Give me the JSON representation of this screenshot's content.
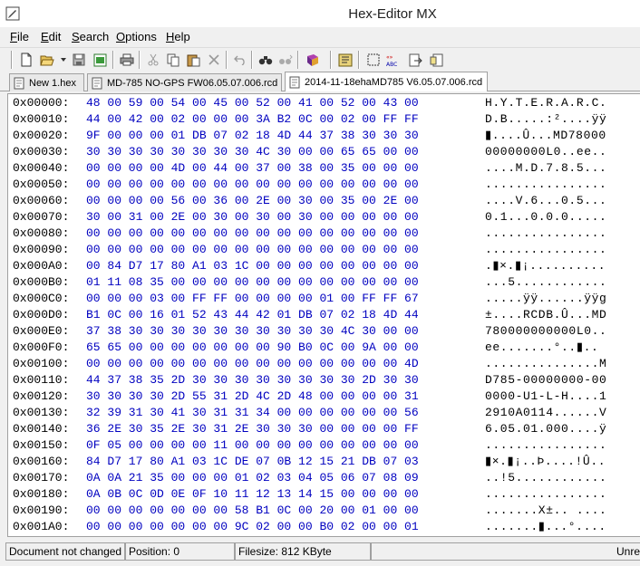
{
  "window": {
    "title": "Hex-Editor MX"
  },
  "menu": [
    {
      "label": "File",
      "accel": "F",
      "rest": "ile"
    },
    {
      "label": "Edit",
      "accel": "E",
      "rest": "dit"
    },
    {
      "label": "Search",
      "accel": "S",
      "rest": "earch"
    },
    {
      "label": "Options",
      "accel": "O",
      "rest": "ptions"
    },
    {
      "label": "Help",
      "accel": "H",
      "rest": "elp"
    }
  ],
  "toolbar": {
    "icons": [
      "new-icon",
      "open-icon",
      "save-icon",
      "save-all-icon",
      "print-icon",
      "cut-icon",
      "copy-icon",
      "paste-icon",
      "delete-icon",
      "undo-icon",
      "find-icon",
      "find-next-icon",
      "bookmark-icon",
      "settings-icon",
      "select-icon",
      "encoding-icon",
      "export-icon",
      "import-icon"
    ]
  },
  "tabs": [
    {
      "label": "New 1.hex",
      "active": false
    },
    {
      "label": "MD-785 NO-GPS FW06.05.07.006.rcd",
      "active": false
    },
    {
      "label": "2014-11-18ehaMD785 V6.05.07.006.rcd",
      "active": true
    }
  ],
  "hex_rows": [
    {
      "addr": "0x00000:",
      "hex": "48 00 59 00 54 00 45 00 52 00 41 00 52 00 43 00",
      "ascii": "H.Y.T.E.R.A.R.C."
    },
    {
      "addr": "0x00010:",
      "hex": "44 00 42 00 02 00 00 00 3A B2 0C 00 02 00 FF FF",
      "ascii": "D.B.....:²....ÿÿ"
    },
    {
      "addr": "0x00020:",
      "hex": "9F 00 00 00 01 DB 07 02 18 4D 44 37 38 30 30 30",
      "ascii": "▮....Û...MD78000"
    },
    {
      "addr": "0x00030:",
      "hex": "30 30 30 30 30 30 30 30 4C 30 00 00 65 65 00 00",
      "ascii": "00000000L0..ee.."
    },
    {
      "addr": "0x00040:",
      "hex": "00 00 00 00 4D 00 44 00 37 00 38 00 35 00 00 00",
      "ascii": "....M.D.7.8.5..."
    },
    {
      "addr": "0x00050:",
      "hex": "00 00 00 00 00 00 00 00 00 00 00 00 00 00 00 00",
      "ascii": "................"
    },
    {
      "addr": "0x00060:",
      "hex": "00 00 00 00 56 00 36 00 2E 00 30 00 35 00 2E 00",
      "ascii": "....V.6...0.5..."
    },
    {
      "addr": "0x00070:",
      "hex": "30 00 31 00 2E 00 30 00 30 00 30 00 00 00 00 00",
      "ascii": "0.1...0.0.0....."
    },
    {
      "addr": "0x00080:",
      "hex": "00 00 00 00 00 00 00 00 00 00 00 00 00 00 00 00",
      "ascii": "................"
    },
    {
      "addr": "0x00090:",
      "hex": "00 00 00 00 00 00 00 00 00 00 00 00 00 00 00 00",
      "ascii": "................"
    },
    {
      "addr": "0x000A0:",
      "hex": "00 84 D7 17 80 A1 03 1C 00 00 00 00 00 00 00 00",
      "ascii": ".▮×.▮¡.........."
    },
    {
      "addr": "0x000B0:",
      "hex": "01 11 08 35 00 00 00 00 00 00 00 00 00 00 00 00",
      "ascii": "...5............"
    },
    {
      "addr": "0x000C0:",
      "hex": "00 00 00 03 00 FF FF 00 00 00 00 01 00 FF FF 67",
      "ascii": ".....ÿÿ......ÿÿg"
    },
    {
      "addr": "0x000D0:",
      "hex": "B1 0C 00 16 01 52 43 44 42 01 DB 07 02 18 4D 44",
      "ascii": "±....RCDB.Û...MD"
    },
    {
      "addr": "0x000E0:",
      "hex": "37 38 30 30 30 30 30 30 30 30 30 30 4C 30 00 00",
      "ascii": "780000000000L0.."
    },
    {
      "addr": "0x000F0:",
      "hex": "65 65 00 00 00 00 00 00 00 90 B0 0C 00 9A 00 00",
      "ascii": "ee.......°..▮.."
    },
    {
      "addr": "0x00100:",
      "hex": "00 00 00 00 00 00 00 00 00 00 00 00 00 00 00 4D",
      "ascii": "...............M"
    },
    {
      "addr": "0x00110:",
      "hex": "44 37 38 35 2D 30 30 30 30 30 30 30 30 2D 30 30",
      "ascii": "D785-00000000-00"
    },
    {
      "addr": "0x00120:",
      "hex": "30 30 30 30 2D 55 31 2D 4C 2D 48 00 00 00 00 31",
      "ascii": "0000-U1-L-H....1"
    },
    {
      "addr": "0x00130:",
      "hex": "32 39 31 30 41 30 31 31 34 00 00 00 00 00 00 56",
      "ascii": "2910A0114......V"
    },
    {
      "addr": "0x00140:",
      "hex": "36 2E 30 35 2E 30 31 2E 30 30 30 00 00 00 00 FF",
      "ascii": "6.05.01.000....ÿ"
    },
    {
      "addr": "0x00150:",
      "hex": "0F 05 00 00 00 00 11 00 00 00 00 00 00 00 00 00",
      "ascii": "................"
    },
    {
      "addr": "0x00160:",
      "hex": "84 D7 17 80 A1 03 1C DE 07 0B 12 15 21 DB 07 03",
      "ascii": "▮×.▮¡..Þ....!Û.."
    },
    {
      "addr": "0x00170:",
      "hex": "0A 0A 21 35 00 00 00 01 02 03 04 05 06 07 08 09",
      "ascii": "..!5............"
    },
    {
      "addr": "0x00180:",
      "hex": "0A 0B 0C 0D 0E 0F 10 11 12 13 14 15 00 00 00 00",
      "ascii": "................"
    },
    {
      "addr": "0x00190:",
      "hex": "00 00 00 00 00 00 00 58 B1 0C 00 20 00 01 00 00",
      "ascii": ".......X±.. ...."
    },
    {
      "addr": "0x001A0:",
      "hex": "00 00 00 00 00 00 00 9C 02 00 00 B0 02 00 00 01",
      "ascii": ".......▮...°...."
    }
  ],
  "status": {
    "doc_state": "Document not changed",
    "position": "Position: 0",
    "filesize": "Filesize: 812 KByte",
    "extra": "Unre"
  }
}
